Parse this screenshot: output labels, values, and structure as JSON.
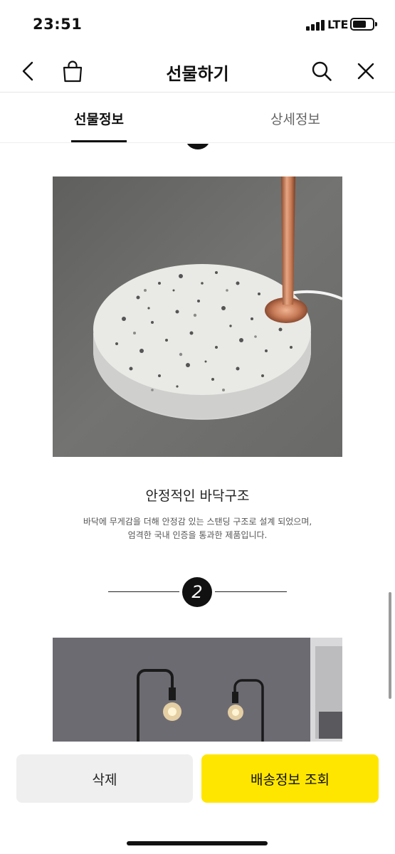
{
  "status_bar": {
    "time": "23:51",
    "network": "LTE"
  },
  "header": {
    "title": "선물하기",
    "icons": [
      "back-chevron-icon",
      "shopping-bag-icon",
      "search-icon",
      "close-icon"
    ]
  },
  "tabs": [
    {
      "label": "선물정보",
      "active": true
    },
    {
      "label": "상세정보",
      "active": false
    }
  ],
  "content": {
    "section_title": "안정적인 바닥구조",
    "section_desc_line1": "바닥에 무게감을 더해 안정감 있는 스탠딩 구조로 설계 되었으며,",
    "section_desc_line2": "엄격한 국내 인증을 통과한 제품입니다.",
    "step_number": "2"
  },
  "buttons": {
    "delete": "삭제",
    "track_delivery": "배송정보 조회"
  },
  "colors": {
    "accent_yellow": "#ffe600",
    "secondary_button": "#efefef",
    "text_primary": "#111111"
  }
}
